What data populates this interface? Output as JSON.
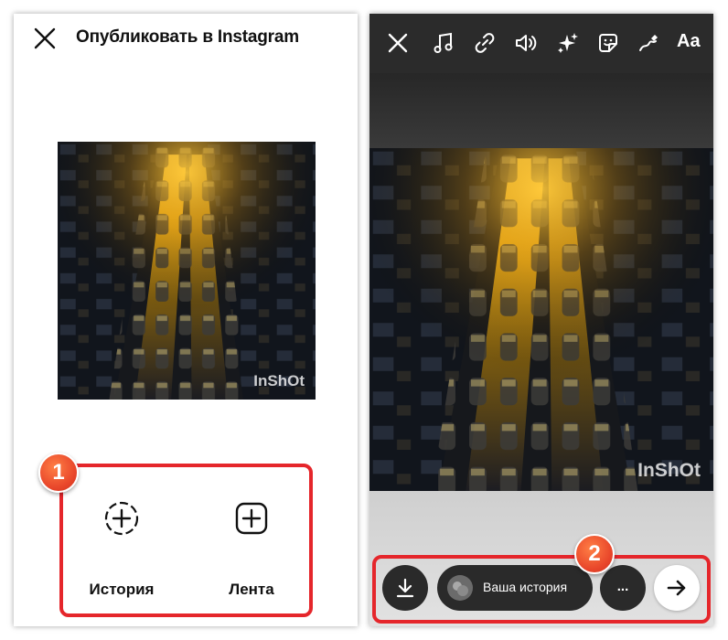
{
  "left_screen": {
    "title": "Опубликовать в Instagram",
    "watermark": "InShOt",
    "options": [
      {
        "label": "История",
        "icon": "dashed-circle-plus-icon"
      },
      {
        "label": "Лента",
        "icon": "square-plus-icon"
      }
    ]
  },
  "right_screen": {
    "toolbar": {
      "icons": [
        "close-icon",
        "music-icon",
        "link-icon",
        "sound-icon",
        "effects-sparkle-icon",
        "sticker-icon",
        "draw-icon"
      ],
      "text_tool_label": "Aa"
    },
    "watermark": "InShOt",
    "bottom_bar": {
      "download_icon": "download-icon",
      "story_label": "Ваша история",
      "more_label": "...",
      "next_icon": "arrow-right-icon"
    }
  },
  "annotations": {
    "badge_1": "1",
    "badge_2": "2",
    "highlight_color": "#e5262b"
  },
  "colors": {
    "accent_badge": "#e8452a",
    "dark_button": "#2a2a2a",
    "story_bg": "#2b2b2b"
  }
}
